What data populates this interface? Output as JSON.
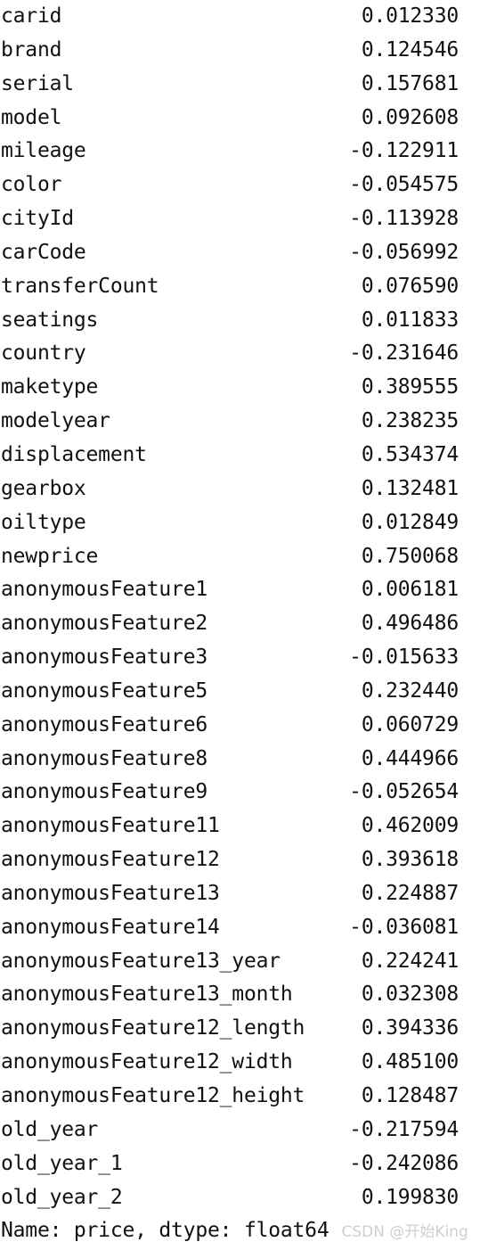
{
  "output": {
    "kind": "pandas-series-repr",
    "rows": [
      {
        "label": "carid",
        "value": "0.012330"
      },
      {
        "label": "brand",
        "value": "0.124546"
      },
      {
        "label": "serial",
        "value": "0.157681"
      },
      {
        "label": "model",
        "value": "0.092608"
      },
      {
        "label": "mileage",
        "value": "-0.122911"
      },
      {
        "label": "color",
        "value": "-0.054575"
      },
      {
        "label": "cityId",
        "value": "-0.113928"
      },
      {
        "label": "carCode",
        "value": "-0.056992"
      },
      {
        "label": "transferCount",
        "value": "0.076590"
      },
      {
        "label": "seatings",
        "value": "0.011833"
      },
      {
        "label": "country",
        "value": "-0.231646"
      },
      {
        "label": "maketype",
        "value": "0.389555"
      },
      {
        "label": "modelyear",
        "value": "0.238235"
      },
      {
        "label": "displacement",
        "value": "0.534374"
      },
      {
        "label": "gearbox",
        "value": "0.132481"
      },
      {
        "label": "oiltype",
        "value": "0.012849"
      },
      {
        "label": "newprice",
        "value": "0.750068"
      },
      {
        "label": "anonymousFeature1",
        "value": "0.006181"
      },
      {
        "label": "anonymousFeature2",
        "value": "0.496486"
      },
      {
        "label": "anonymousFeature3",
        "value": "-0.015633"
      },
      {
        "label": "anonymousFeature5",
        "value": "0.232440"
      },
      {
        "label": "anonymousFeature6",
        "value": "0.060729"
      },
      {
        "label": "anonymousFeature8",
        "value": "0.444966"
      },
      {
        "label": "anonymousFeature9",
        "value": "-0.052654"
      },
      {
        "label": "anonymousFeature11",
        "value": "0.462009"
      },
      {
        "label": "anonymousFeature12",
        "value": "0.393618"
      },
      {
        "label": "anonymousFeature13",
        "value": "0.224887"
      },
      {
        "label": "anonymousFeature14",
        "value": "-0.036081"
      },
      {
        "label": "anonymousFeature13_year",
        "value": "0.224241"
      },
      {
        "label": "anonymousFeature13_month",
        "value": "0.032308"
      },
      {
        "label": "anonymousFeature12_length",
        "value": "0.394336"
      },
      {
        "label": "anonymousFeature12_width",
        "value": "0.485100"
      },
      {
        "label": "anonymousFeature12_height",
        "value": "0.128487"
      },
      {
        "label": "old_year",
        "value": "-0.217594"
      },
      {
        "label": "old_year_1",
        "value": "-0.242086"
      },
      {
        "label": "old_year_2",
        "value": "0.199830"
      }
    ],
    "footer": "Name: price, dtype: float64",
    "watermark": "CSDN @开始King"
  },
  "chart_data": {
    "type": "table",
    "title": "Name: price, dtype: float64",
    "xlabel": "",
    "ylabel": "",
    "categories": [
      "carid",
      "brand",
      "serial",
      "model",
      "mileage",
      "color",
      "cityId",
      "carCode",
      "transferCount",
      "seatings",
      "country",
      "maketype",
      "modelyear",
      "displacement",
      "gearbox",
      "oiltype",
      "newprice",
      "anonymousFeature1",
      "anonymousFeature2",
      "anonymousFeature3",
      "anonymousFeature5",
      "anonymousFeature6",
      "anonymousFeature8",
      "anonymousFeature9",
      "anonymousFeature11",
      "anonymousFeature12",
      "anonymousFeature13",
      "anonymousFeature14",
      "anonymousFeature13_year",
      "anonymousFeature13_month",
      "anonymousFeature12_length",
      "anonymousFeature12_width",
      "anonymousFeature12_height",
      "old_year",
      "old_year_1",
      "old_year_2"
    ],
    "values": [
      0.01233,
      0.124546,
      0.157681,
      0.092608,
      -0.122911,
      -0.054575,
      -0.113928,
      -0.056992,
      0.07659,
      0.011833,
      -0.231646,
      0.389555,
      0.238235,
      0.534374,
      0.132481,
      0.012849,
      0.750068,
      0.006181,
      0.496486,
      -0.015633,
      0.23244,
      0.060729,
      0.444966,
      -0.052654,
      0.462009,
      0.393618,
      0.224887,
      -0.036081,
      0.224241,
      0.032308,
      0.394336,
      0.4851,
      0.128487,
      -0.217594,
      -0.242086,
      0.19983
    ]
  }
}
